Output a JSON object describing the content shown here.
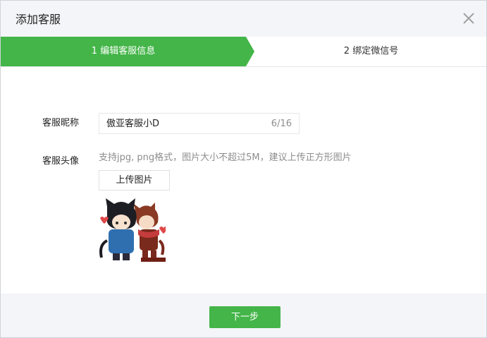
{
  "dialog": {
    "title": "添加客服"
  },
  "steps": [
    {
      "label": "1 编辑客服信息",
      "active": true
    },
    {
      "label": "2 绑定微信号",
      "active": false
    }
  ],
  "form": {
    "nickname_label": "客服昵称",
    "nickname_value": "傲亚客服小D",
    "nickname_counter": "6/16",
    "avatar_label": "客服头像",
    "avatar_hint": "支持jpg, png格式，图片大小不超过5M，建议上传正方形图片",
    "upload_button": "上传图片"
  },
  "footer": {
    "next_button": "下一步"
  },
  "colors": {
    "accent": "#44b549",
    "header_bg": "#f4f5f9"
  },
  "icons": {
    "close": "close-icon"
  }
}
